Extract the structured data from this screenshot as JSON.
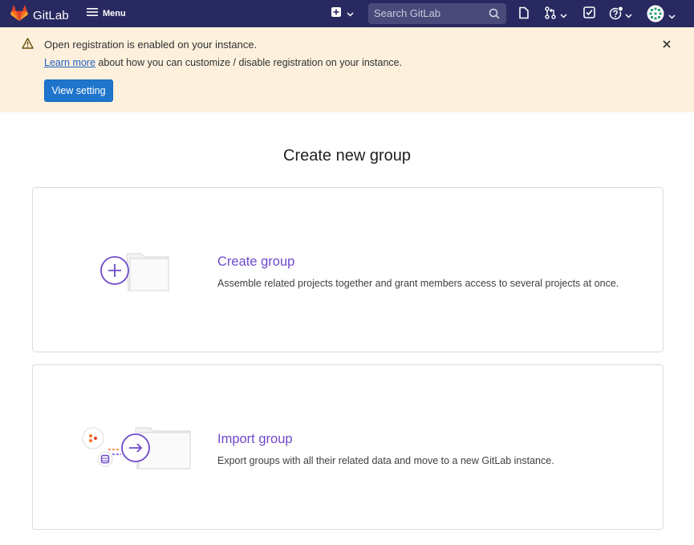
{
  "navbar": {
    "brand": "GitLab",
    "menu_label": "Menu",
    "search_placeholder": "Search GitLab",
    "icons": [
      "gitlab-logo-icon",
      "hamburger-icon",
      "plus-square-icon",
      "chevron-down-icon",
      "search-icon",
      "issues-icon",
      "merge-request-icon",
      "todo-icon",
      "help-icon",
      "avatar"
    ]
  },
  "alert": {
    "title": "Open registration is enabled on your instance.",
    "link_text": "Learn more",
    "body_text": " about how you can customize / disable registration on your instance.",
    "button_label": "View setting",
    "colors": {
      "background": "#fdf1dd",
      "icon": "#7a5a12",
      "button": "#1f75cb"
    }
  },
  "main": {
    "title": "Create new group",
    "cards": [
      {
        "title": "Create group",
        "description": "Assemble related projects together and grant members access to several projects at once."
      },
      {
        "title": "Import group",
        "description": "Export groups with all their related data and move to a new GitLab instance."
      }
    ]
  },
  "colors": {
    "navbar": "#292961",
    "accent": "#6e49cb",
    "brand_orange": "#fc6d26"
  }
}
